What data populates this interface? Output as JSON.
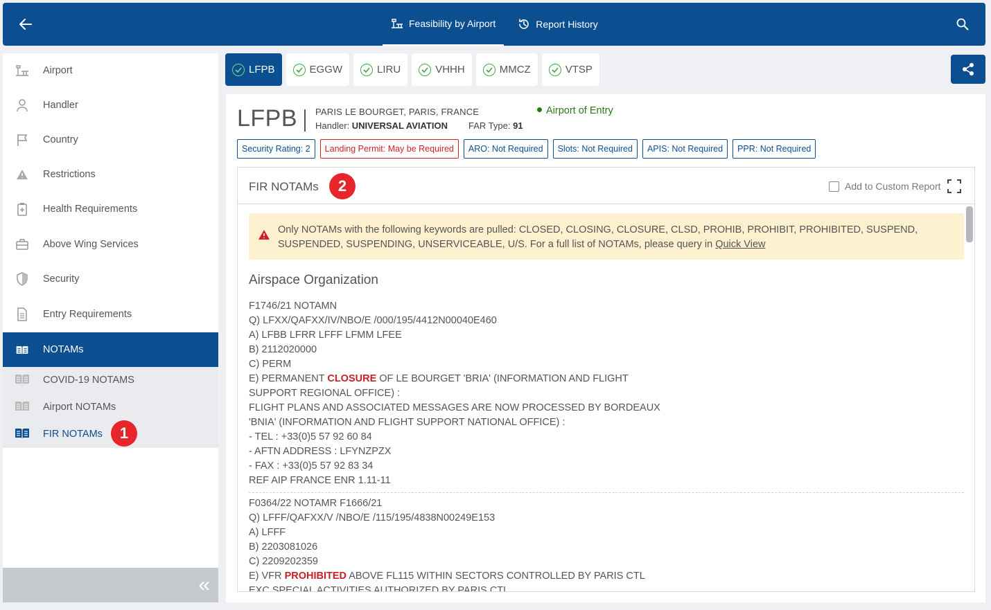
{
  "topbar": {
    "nav": [
      {
        "label": "Feasibility by Airport",
        "active": true,
        "icon": "airport-icon"
      },
      {
        "label": "Report History",
        "active": false,
        "icon": "history-icon"
      }
    ]
  },
  "sidebar": {
    "items": [
      {
        "label": "Airport",
        "icon": "airport-icon"
      },
      {
        "label": "Handler",
        "icon": "person-icon"
      },
      {
        "label": "Country",
        "icon": "flag-icon"
      },
      {
        "label": "Restrictions",
        "icon": "warning-icon"
      },
      {
        "label": "Health Requirements",
        "icon": "health-icon"
      },
      {
        "label": "Above Wing Services",
        "icon": "briefcase-icon"
      },
      {
        "label": "Security",
        "icon": "shield-icon"
      },
      {
        "label": "Entry Requirements",
        "icon": "document-icon"
      },
      {
        "label": "NOTAMs",
        "icon": "book-icon",
        "active": true
      }
    ],
    "subitems": [
      {
        "label": "COVID-19 NOTAMS"
      },
      {
        "label": "Airport NOTAMs"
      },
      {
        "label": "FIR NOTAMs",
        "current": true
      }
    ],
    "badge_1": "1",
    "collapse_label": "«"
  },
  "tabs": [
    {
      "label": "LFPB",
      "active": true
    },
    {
      "label": "EGGW"
    },
    {
      "label": "LIRU"
    },
    {
      "label": "VHHH"
    },
    {
      "label": "MMCZ"
    },
    {
      "label": "VTSP"
    }
  ],
  "airport": {
    "code": "LFPB",
    "name": "PARIS LE BOURGET, PARIS, FRANCE",
    "handler_label": "Handler:",
    "handler_value": "UNIVERSAL AVIATION",
    "far_label": "FAR Type:",
    "far_value": "91",
    "entry": "Airport of Entry"
  },
  "chips": [
    {
      "label": "Security Rating: 2",
      "status": "blue"
    },
    {
      "label": "Landing Permit: May be Required",
      "status": "red"
    },
    {
      "label": "ARO: Not Required",
      "status": "blue"
    },
    {
      "label": "Slots: Not Required",
      "status": "blue"
    },
    {
      "label": "APIS: Not Required",
      "status": "blue"
    },
    {
      "label": "PPR: Not Required",
      "status": "blue"
    }
  ],
  "card": {
    "title": "FIR NOTAMs",
    "badge_2": "2",
    "add_custom": "Add to Custom Report",
    "warning_text": "Only NOTAMs with the following keywords are pulled: CLOSED, CLOSING, CLOSURE, CLSD, PROHIB, PROHIBIT, PROHIBITED, SUSPEND, SUSPENDED, SUSPENDING, UNSERVICEABLE, U/S. For a full list of NOTAMs, please query in",
    "warning_link": "Quick View",
    "section": "Airspace Organization"
  },
  "notams": [
    {
      "lines": [
        "F1746/21 NOTAMN",
        "Q) LFXX/QAFXX/IV/NBO/E /000/195/4412N00040E460",
        "A) LFBB LFRR LFFF LFMM LFEE",
        "B) 2112020000",
        "C) PERM",
        {
          "pre": "E) PERMANENT ",
          "kw": "CLOSURE",
          "post": " OF LE BOURGET 'BRIA' (INFORMATION AND FLIGHT"
        },
        "SUPPORT REGIONAL OFFICE) :",
        "FLIGHT PLANS AND ASSOCIATED MESSAGES ARE NOW PROCESSED BY BORDEAUX",
        "'BNIA' (INFORMATION AND FLIGHT SUPPORT NATIONAL OFFICE) :",
        "- TEL : +33(0)5 57 92 60 84",
        "- AFTN ADDRESS : LFYNZPZX",
        "- FAX : +33(0)5 57 92 83 34",
        "REF AIP FRANCE ENR 1.11-11"
      ]
    },
    {
      "lines": [
        "F0364/22 NOTAMR F1666/21",
        "Q) LFFF/QAFXX/V /NBO/E /115/195/4838N00249E153",
        "A) LFFF",
        "B) 2203081026",
        "C) 2209202359",
        {
          "pre": "E) VFR ",
          "kw": "PROHIBITED",
          "post": " ABOVE FL115 WITHIN SECTORS CONTROLLED BY PARIS CTL"
        },
        "EXC SPECIAL ACTIVITIES AUTHORIZED BY PARIS CTL"
      ]
    }
  ]
}
